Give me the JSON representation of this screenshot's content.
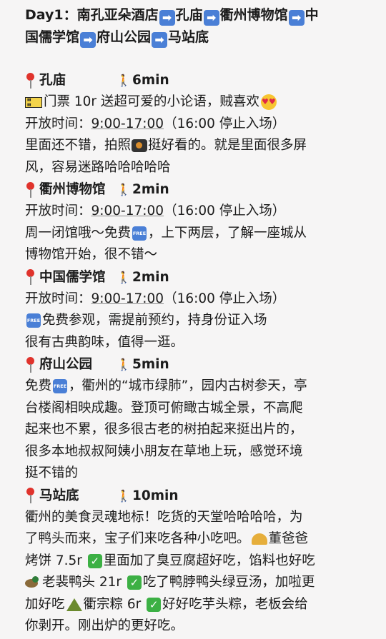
{
  "title": {
    "parts": [
      "Day1：南孔亚朵酒店",
      "孔庙",
      "衢州博物馆",
      "中",
      "国儒学馆",
      "府山公园",
      "马站底"
    ]
  },
  "sections": [
    {
      "place": "孔庙",
      "walk": "6min",
      "lines": [
        {
          "icon_before": "ticket-icon",
          "text": "门票 10r 送超可爱的小论语，贼喜欢",
          "icon_after": "heart-eyes-icon"
        },
        {
          "text_a": "开放时间：",
          "time": "9:00-17:00",
          "text_b": "（16:00 停止入场）"
        },
        {
          "text_a": "里面还不错，拍照",
          "icon": "camera-icon",
          "text_b": "挺好看的。就是里面很多屏"
        },
        {
          "text": "风，容易迷路哈哈哈哈哈"
        }
      ]
    },
    {
      "place": "衢州博物馆",
      "walk": "2min",
      "lines": [
        {
          "text_a": "开放时间：",
          "time": "9:00-17:00",
          "text_b": "（16:00 停止入场）"
        },
        {
          "text_a": "周一闭馆哦～免费",
          "icon": "free-icon",
          "text_b": "，上下两层，了解一座城从"
        },
        {
          "text": "博物馆开始，很不错～"
        }
      ]
    },
    {
      "place": "中国儒学馆",
      "walk": "2min",
      "lines": [
        {
          "text_a": "开放时间：",
          "time": "9:00-17:00",
          "text_b": "（16:00 停止入场）"
        },
        {
          "icon_before": "free-icon",
          "text": "免费参观，需提前预约，持身份证入场"
        },
        {
          "text": "很有古典韵味，值得一逛。"
        }
      ]
    },
    {
      "place": "府山公园",
      "walk": "5min",
      "lines": [
        {
          "text_a": "免费",
          "icon": "free-icon",
          "text_b": "，衢州的“城市绿肺”，园内古树参天，亭"
        },
        {
          "text": "台楼阁相映成趣。登顶可俯瞰古城全景，不高爬"
        },
        {
          "text": "起来也不累，很多很古老的树拍起来挺出片的，"
        },
        {
          "text": "很多本地叔叔阿姨小朋友在草地上玩，感觉环境"
        },
        {
          "text": "挺不错的"
        }
      ]
    },
    {
      "place": "马站底",
      "walk": "10min",
      "lines": [
        {
          "text": "衢州的美食灵魂地标！吃货的天堂哈哈哈哈，为"
        },
        {
          "text_a": "了鸭头而来，宝子们来吃各种小吃吧。",
          "icon": "taco-icon",
          "text_b": "董爸爸"
        },
        {
          "text_a": "烤饼 7.5r ",
          "icon": "check-icon",
          "text_b": "里面加了臭豆腐超好吃，馅料也好吃"
        },
        {
          "icon_before": "duck-icon",
          "text_a": "老裴鸭头 21r ",
          "icon": "check-icon",
          "text_b": "吃了鸭脖鸭头绿豆汤，加啦更"
        },
        {
          "text_a": "加好吃",
          "icon": "zongzi-icon",
          "text_b": "衢宗粽 6r ",
          "icon2": "check-icon",
          "text_c": "好好吃芋头粽，老板会给"
        },
        {
          "text": "你剥开。刚出炉的更好吃。"
        }
      ]
    }
  ],
  "icons": {
    "pin": "round-pushpin-icon",
    "walk": "person-walking-icon",
    "arrow": "right-arrow-icon",
    "free_label": "FREE",
    "check_label": "✓"
  }
}
